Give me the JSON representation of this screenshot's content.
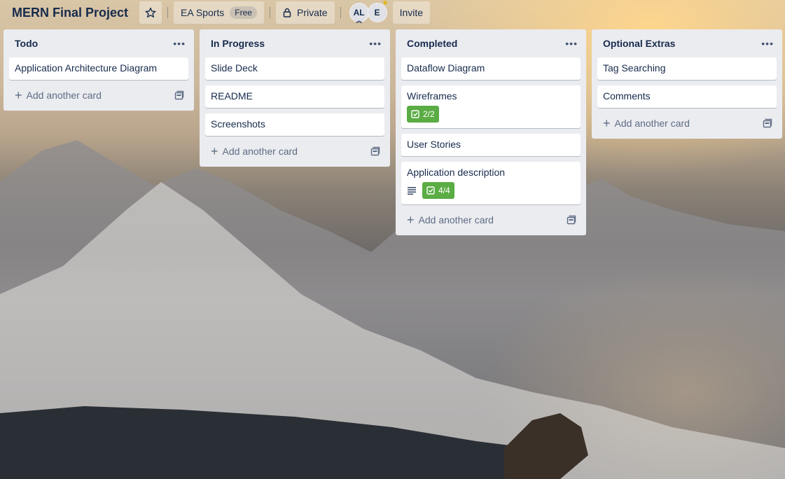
{
  "board": {
    "title": "MERN Final Project",
    "workspace": "EA Sports",
    "workspace_plan": "Free",
    "visibility": "Private",
    "members": [
      {
        "initials": "AL"
      },
      {
        "initials": "E"
      }
    ],
    "invite_label": "Invite"
  },
  "lists": [
    {
      "title": "Todo",
      "cards": [
        {
          "title": "Application Architecture Diagram"
        }
      ],
      "add_card_label": "Add another card"
    },
    {
      "title": "In Progress",
      "cards": [
        {
          "title": "Slide Deck"
        },
        {
          "title": "README"
        },
        {
          "title": "Screenshots"
        }
      ],
      "add_card_label": "Add another card"
    },
    {
      "title": "Completed",
      "cards": [
        {
          "title": "Dataflow Diagram"
        },
        {
          "title": "Wireframes",
          "checklist": "2/2"
        },
        {
          "title": "User Stories"
        },
        {
          "title": "Application description",
          "has_description": true,
          "checklist": "4/4"
        }
      ],
      "add_card_label": "Add another card"
    },
    {
      "title": "Optional Extras",
      "cards": [
        {
          "title": "Tag Searching"
        },
        {
          "title": "Comments"
        }
      ],
      "add_card_label": "Add another card"
    }
  ],
  "colors": {
    "list_bg": "#ebecf0",
    "checklist_complete": "#5aac44"
  },
  "icons": {
    "menu": "ellipsis-icon",
    "add": "plus-icon",
    "template": "card-template-icon",
    "star": "star-icon",
    "lock": "lock-icon",
    "description": "description-icon",
    "checklist": "checklist-icon"
  }
}
